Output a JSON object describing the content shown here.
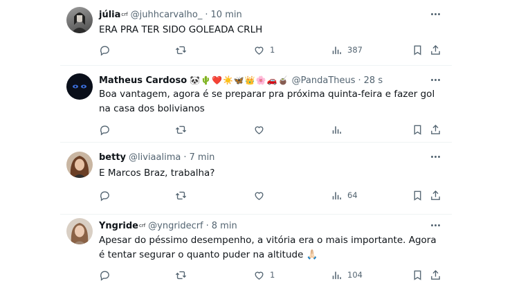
{
  "tweets": [
    {
      "name": "júlia",
      "badge": "crf",
      "handle": "@juhhcarvalho_",
      "time": "10 min",
      "emojis": "",
      "text": "ERA PRA TER SIDO GOLEADA CRLH",
      "likes": "1",
      "views": "387",
      "avatar_color": "#6b6b6b"
    },
    {
      "name": "Matheus Cardoso",
      "badge": "",
      "handle": "@PandaTheus",
      "time": "28 s",
      "emojis": "🐼🌵❤️☀️🦋👑🌸🚗🧉",
      "text": "Boa vantagem, agora é se preparar pra próxima quinta-feira e fazer gol na casa dos bolivianos",
      "likes": "",
      "views": "",
      "avatar_color": "#0a0f1a"
    },
    {
      "name": "betty",
      "badge": "",
      "handle": "@liviaalima",
      "time": "7 min",
      "emojis": "",
      "text": "E Marcos Braz, trabalha?",
      "likes": "",
      "views": "64",
      "avatar_color": "#8a6a52"
    },
    {
      "name": "Yngride",
      "badge": "crf",
      "handle": "@yngridecrf",
      "time": "8 min",
      "emojis": "",
      "text": "Apesar do péssimo desempenho, a vitória era o mais importante. Agora é tentar segurar o quanto puder na altitude 🙏🏻",
      "likes": "1",
      "views": "104",
      "avatar_color": "#b09a86"
    }
  ],
  "icons": {
    "reply": "reply-icon",
    "retweet": "retweet-icon",
    "like": "heart-icon",
    "views": "views-icon",
    "bookmark": "bookmark-icon",
    "share": "share-icon",
    "more": "more-icon"
  },
  "colors": {
    "text": "#0f1419",
    "secondary": "#536471",
    "divider": "#eff3f4"
  }
}
